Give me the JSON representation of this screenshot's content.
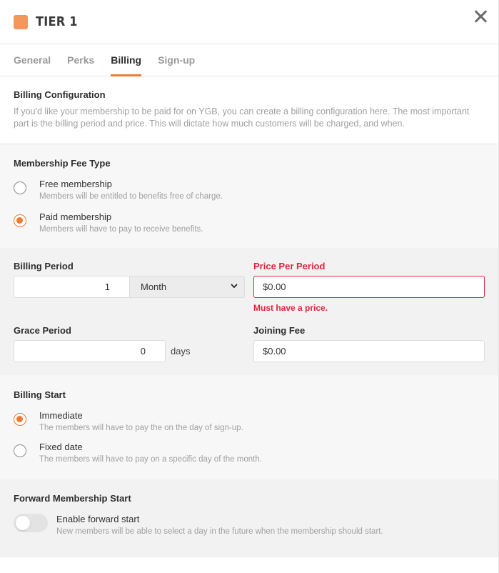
{
  "header": {
    "title": "TIER 1",
    "swatch_color": "#f4975a",
    "close_icon": "close-icon"
  },
  "tabs": [
    {
      "label": "General",
      "active": false
    },
    {
      "label": "Perks",
      "active": false
    },
    {
      "label": "Billing",
      "active": true
    },
    {
      "label": "Sign-up",
      "active": false
    }
  ],
  "intro": {
    "title": "Billing Configuration",
    "description": "If you'd like your membership to be paid for on YGB, you can create a billing configuration here. The most important part is the billing period and price. This will dictate how much customers will be charged, and when."
  },
  "fee_type": {
    "title": "Membership Fee Type",
    "options": [
      {
        "label": "Free membership",
        "sub": "Members will be entitled to benefits free of charge.",
        "checked": false
      },
      {
        "label": "Paid membership",
        "sub": "Members will have to pay to receive benefits.",
        "checked": true
      }
    ]
  },
  "billing": {
    "period_label": "Billing Period",
    "period_value": "1",
    "period_unit": "Month",
    "price_label": "Price Per Period",
    "price_value": "$0.00",
    "price_error": "Must have a price.",
    "grace_label": "Grace Period",
    "grace_value": "0",
    "grace_unit": "days",
    "joining_label": "Joining Fee",
    "joining_value": "$0.00"
  },
  "billing_start": {
    "title": "Billing Start",
    "options": [
      {
        "label": "Immediate",
        "sub": "The members will have to pay the on the day of sign-up.",
        "checked": true
      },
      {
        "label": "Fixed date",
        "sub": "The members will have to pay on a specific day of the month.",
        "checked": false
      }
    ]
  },
  "forward_start": {
    "title": "Forward Membership Start",
    "toggle_label": "Enable forward start",
    "toggle_sub": "New members will be able to select a day in the future when the membership should start.",
    "enabled": false
  },
  "colors": {
    "accent": "#f07a2f",
    "error": "#e0253f"
  }
}
